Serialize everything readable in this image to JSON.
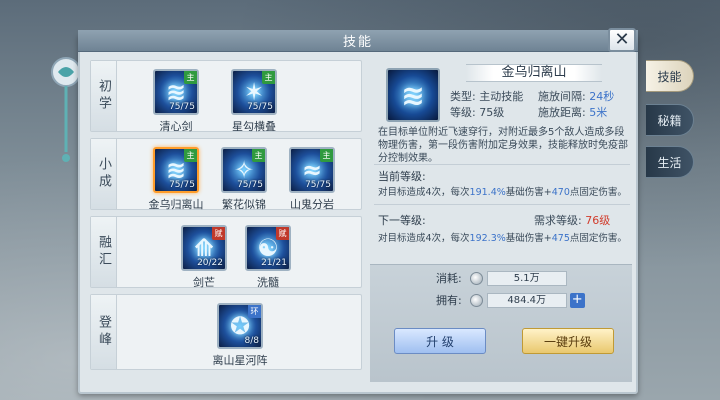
{
  "title": "技能",
  "close_label": "✕",
  "tiers": [
    {
      "label": "初学",
      "skills": [
        {
          "name": "清心剑",
          "level": "75/75",
          "tag": "主",
          "glyph": "≋"
        },
        {
          "name": "星勾横叠",
          "level": "75/75",
          "tag": "主",
          "glyph": "✶"
        }
      ]
    },
    {
      "label": "小成",
      "skills": [
        {
          "name": "金乌归离山",
          "level": "75/75",
          "tag": "主",
          "glyph": "≋",
          "selected": true
        },
        {
          "name": "繁花似锦",
          "level": "75/75",
          "tag": "主",
          "glyph": "✧"
        },
        {
          "name": "山鬼分岩",
          "level": "75/75",
          "tag": "主",
          "glyph": "≈"
        }
      ]
    },
    {
      "label": "融汇",
      "skills": [
        {
          "name": "剑芒",
          "level": "20/22",
          "tag": "赋",
          "glyph": "⟰"
        },
        {
          "name": "洗髓",
          "level": "21/21",
          "tag": "赋",
          "glyph": "☯"
        }
      ]
    },
    {
      "label": "登峰",
      "skills": [
        {
          "name": "离山星河阵",
          "level": "8/8",
          "tag": "环",
          "glyph": "✪"
        }
      ]
    }
  ],
  "detail": {
    "name": "金乌归离山",
    "type_label": "类型:",
    "type_value": "主动技能",
    "interval_label": "施放间隔:",
    "interval_value": "24秒",
    "level_label": "等级:",
    "level_value": "75级",
    "range_label": "施放距离:",
    "range_value": "5米",
    "description": "在目标单位附近飞速穿行，对附近最多5个敌人造成多段物理伤害，第一段伤害附加定身效果，技能释放时免疫部分控制效果。",
    "current_label": "当前等级:",
    "current_prefix": "对目标造成4次，每次",
    "current_pct": "191.4%",
    "current_mid": "基础伤害+",
    "current_fixed": "470",
    "current_suffix": "点固定伤害。",
    "next_label": "下一等级:",
    "need_label": "需求等级:",
    "need_value": "76级",
    "next_prefix": "对目标造成4次，每次",
    "next_pct": "192.3%",
    "next_mid": "基础伤害+",
    "next_fixed": "475",
    "next_suffix": "点固定伤害。"
  },
  "cost": {
    "consume_label": "消耗:",
    "consume_value": "5.1万",
    "own_label": "拥有:",
    "own_value": "484.4万",
    "plus_label": "+"
  },
  "buttons": {
    "upgrade": "升 级",
    "one_click": "一键升级"
  },
  "side_tabs": [
    "技能",
    "秘籍",
    "生活"
  ],
  "colors": {
    "accent_blue": "#3c73c9",
    "need_red": "#d13b2b",
    "selected_orange": "#ff9d2b"
  }
}
